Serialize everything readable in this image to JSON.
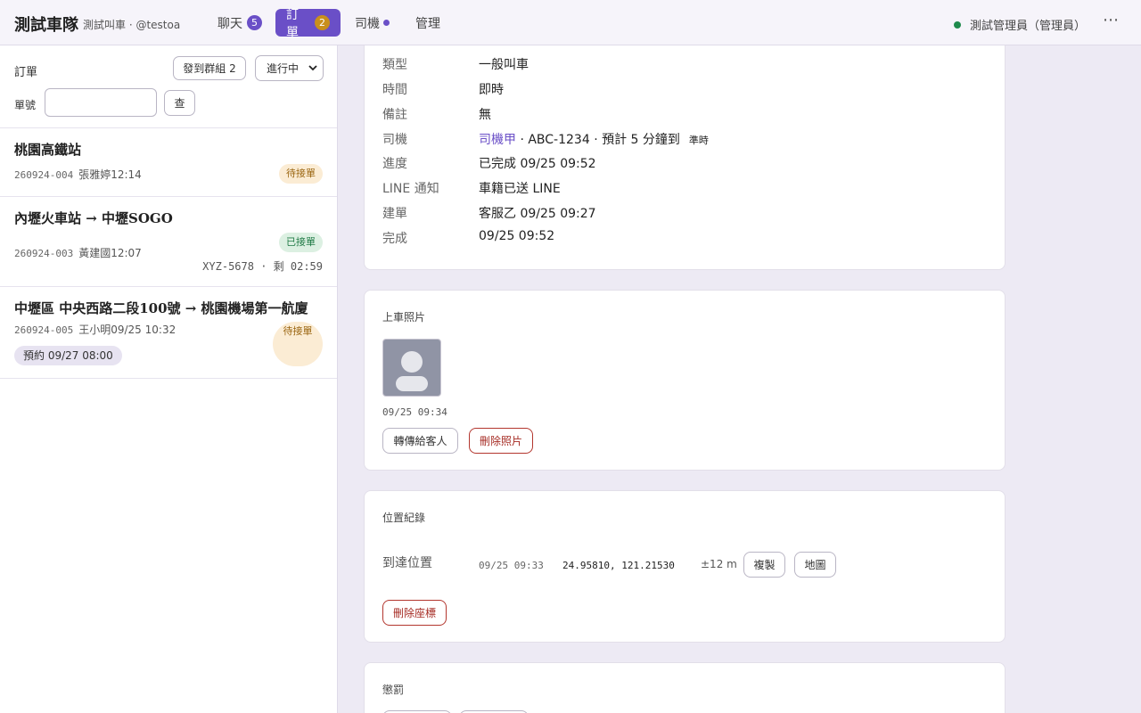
{
  "header": {
    "brand": "測試車隊",
    "subtitle": "測試叫車 · @testoa",
    "tabs": [
      {
        "label": "聊天",
        "badge": "5"
      },
      {
        "label": "訂單",
        "badge": "2"
      },
      {
        "label": "司機"
      },
      {
        "label": "管理"
      }
    ],
    "user": "測試管理員（管理員）",
    "more": "⋯"
  },
  "sidebar": {
    "title": "訂單",
    "send_group_button": "發到群組 2",
    "status_select": "進行中",
    "order_no_label": "單號",
    "search_button": "查",
    "orders": [
      {
        "title": "桃園高鐵站",
        "id": "260924-004",
        "meta": "張雅婷12:14",
        "status": "待接單"
      },
      {
        "title": "內壢火車站 → 中壢SOGO",
        "id": "260924-003",
        "meta": "黃建國12:07",
        "status": "已接單",
        "extra": "XYZ-5678 · 剩 02:59"
      },
      {
        "title": "中壢區 中央西路二段100號 → 桃園機場第一航廈",
        "id": "260924-005",
        "meta": "王小明09/25 10:32",
        "status": "待接單",
        "tag": "預約 09/27 08:00"
      }
    ]
  },
  "detail": {
    "rows": [
      {
        "label": "類型",
        "value": "一般叫車"
      },
      {
        "label": "時間",
        "value": "即時"
      },
      {
        "label": "備註",
        "value": "無"
      },
      {
        "label": "司機",
        "driver": "司機甲",
        "value": " · ABC-1234 · 預計 5 分鐘到",
        "note": "準時"
      },
      {
        "label": "進度",
        "value": "已完成 09/25 09:52"
      },
      {
        "label": "LINE 通知",
        "value": "車籍已送 LINE"
      },
      {
        "label": "建單",
        "value": "客服乙 09/25 09:27"
      },
      {
        "label": "完成",
        "value": "09/25 09:52"
      }
    ]
  },
  "photo_card": {
    "title": "上車照片",
    "time": "09/25 09:34",
    "forward_button": "轉傳給客人",
    "delete_button": "刪除照片"
  },
  "location_card": {
    "title": "位置紀錄",
    "label": "到達位置",
    "time": "09/25 09:33",
    "coords": "24.95810, 121.21530",
    "accuracy": "±12 m",
    "copy_button": "複製",
    "map_button": "地圖",
    "delete_button": "刪除座標"
  },
  "penalty_card": {
    "title": "懲罰"
  },
  "colors": {
    "accent": "#6a4fc7",
    "online": "#1f8a4c",
    "danger": "#a52a22"
  }
}
